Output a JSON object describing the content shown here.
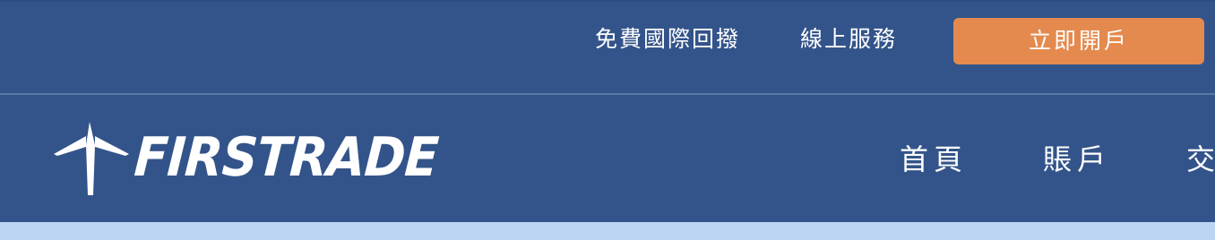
{
  "topbar": {
    "callback_label": "免費國際回撥",
    "online_service_label": "線上服務",
    "open_account_label": "立即開戶"
  },
  "logo": {
    "text": "FIRSTRADE",
    "icon": "firstrade-arrow-logo-icon"
  },
  "nav": {
    "items": [
      {
        "label": "首頁"
      },
      {
        "label": "賬戶"
      },
      {
        "label": "交"
      }
    ]
  },
  "colors": {
    "header_bg": "#33548a",
    "divider": "#5b78a8",
    "accent_button": "#e48a4e",
    "bottom_strip": "#bcd5f2",
    "text": "#ffffff"
  }
}
